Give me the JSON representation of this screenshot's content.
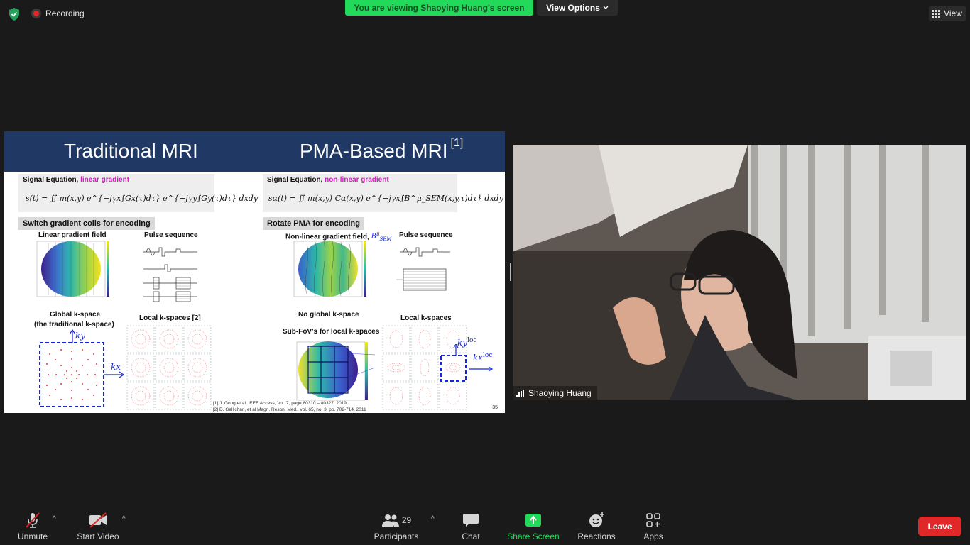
{
  "top": {
    "recording_label": "Recording",
    "banner_text": "You are viewing Shaoying Huang's screen",
    "view_options_label": "View Options",
    "view_label": "View"
  },
  "slide": {
    "title_left": "Traditional MRI",
    "title_right": "PMA-Based MRI",
    "title_right_ref": "[1]",
    "left": {
      "signal_label": "Signal Equation,",
      "signal_highlight": "linear gradient",
      "formula": "s(t) = ∬ m(x,y) e^{−jγx∫Gx(τ)dτ} e^{−jγy∫Gy(τ)dτ} dxdy",
      "section": "Switch gradient coils for encoding",
      "field_label": "Linear gradient field",
      "pulse_label": "Pulse sequence",
      "global_kspace_label": "Global k-space",
      "global_kspace_sub": "(the traditional k-space)",
      "local_kspaces_label": "Local k-spaces [2]",
      "ky_label": "ky",
      "kx_label": "kx"
    },
    "right": {
      "signal_label": "Signal Equation,",
      "signal_highlight": "non-linear gradient",
      "formula": "sα(t) = ∬ m(x,y) Cα(x,y) e^{−jγx∫B^μ_SEM(x,y,τ)dτ} dxdy",
      "section": "Rotate PMA for encoding",
      "field_label": "Non-linear gradient field,",
      "field_symbol": "B",
      "field_symbol_sup": "μ",
      "field_symbol_sub": "SEM",
      "pulse_label": "Pulse sequence",
      "no_global_label": "No global k-space",
      "local_kspaces_label": "Local k-spaces",
      "subfov_label": "Sub-FoV's for local k-spaces",
      "ky_loc_label": "ky",
      "kx_loc_label": "kx",
      "loc_sup": "loc"
    },
    "refs": [
      "[1] J. Gong et al, IEEE Access, Vol. 7, page 80310 – 80327, 2019",
      "[2] D. Gallichan, et al Magn. Reson. Med., vol. 65, no. 3, pp. 702-714, 2011"
    ],
    "page_number": "35"
  },
  "camera": {
    "name": "Shaoying Huang"
  },
  "toolbar": {
    "unmute": "Unmute",
    "start_video": "Start Video",
    "participants": "Participants",
    "participants_count": "29",
    "chat": "Chat",
    "share_screen": "Share Screen",
    "reactions": "Reactions",
    "apps": "Apps",
    "leave": "Leave"
  },
  "colors": {
    "banner_green": "#23d959",
    "leave_red": "#e02828",
    "slide_header": "#1f3864",
    "highlight_magenta": "#e013c8"
  }
}
